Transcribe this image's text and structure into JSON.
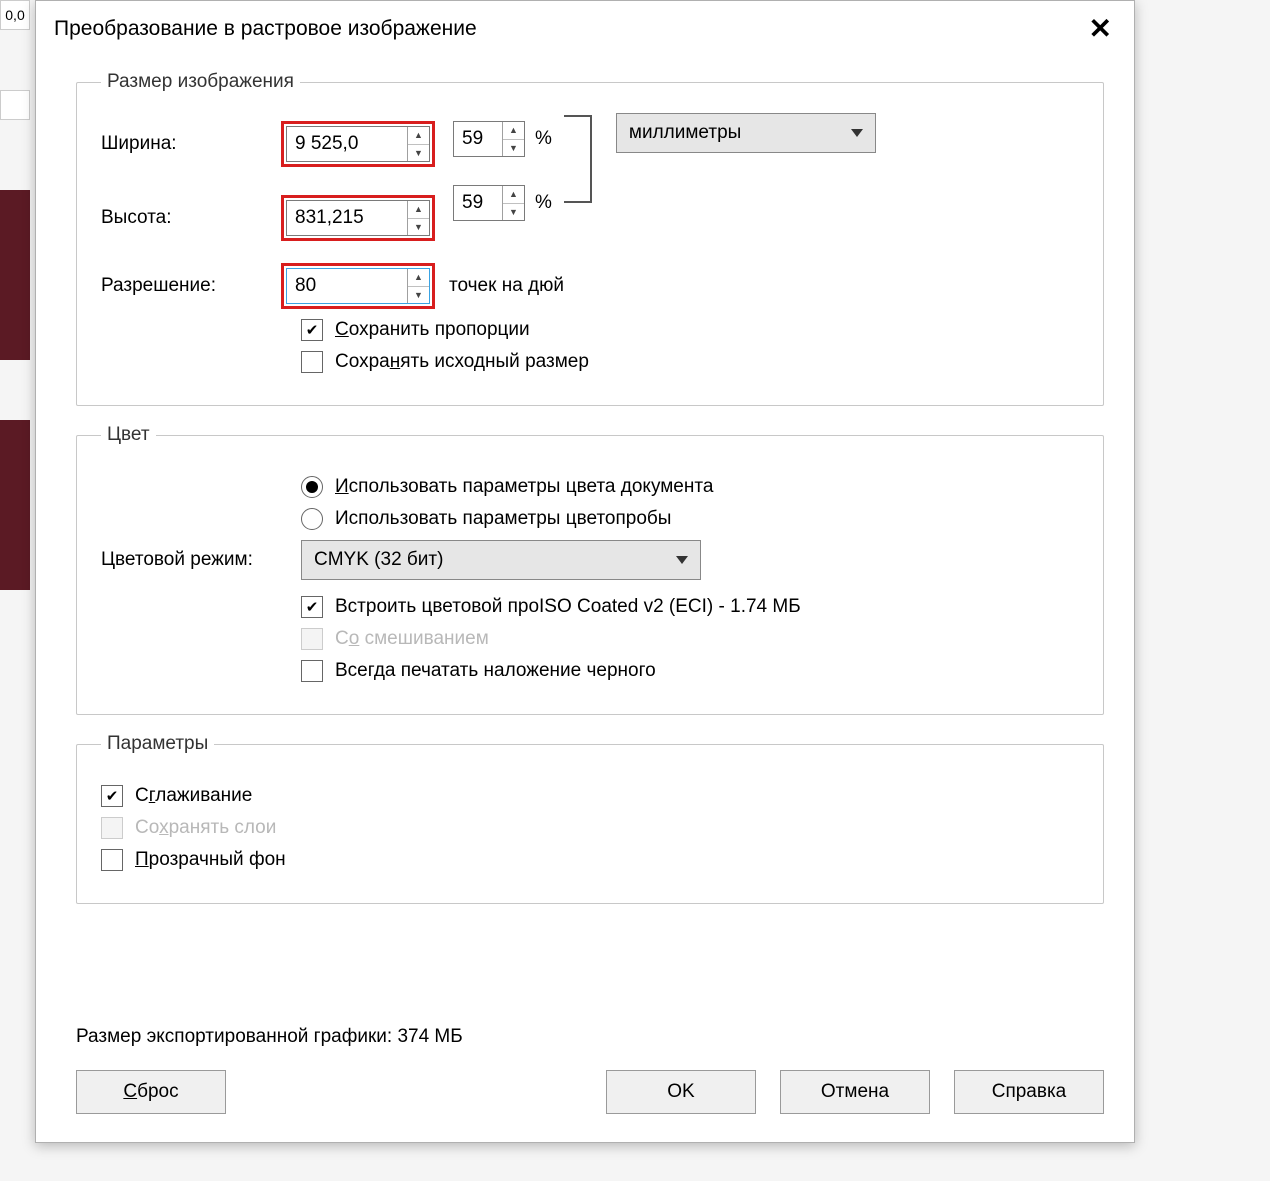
{
  "bg": {
    "ruler_value": "0,0"
  },
  "dialog": {
    "title": "Преобразование в растровое изображение",
    "close": "✕"
  },
  "image_size": {
    "legend": "Размер изображения",
    "width_label": "Ширина:",
    "height_label": "Высота:",
    "resolution_label": "Разрешение:",
    "width_value": "9 525,0",
    "height_value": "831,215",
    "width_percent": "59",
    "height_percent": "59",
    "percent_symbol": "%",
    "resolution_value": "80",
    "resolution_unit": "точек на дюй",
    "units_dropdown": "миллиметры",
    "keep_ratio": "Сохранить пропорции",
    "keep_original_size": "Сохранять исходный размер"
  },
  "color": {
    "legend": "Цвет",
    "use_doc_colors": "Использовать параметры цвета документа",
    "use_proof_colors": "Использовать параметры цветопробы",
    "mode_label": "Цветовой режим:",
    "mode_value": "CMYK (32 бит)",
    "embed_profile": "Встроить цветовой про",
    "profile_info": "ISO Coated v2 (ECI) - 1.74 МБ",
    "dither": "Со смешиванием",
    "always_overprint": "Всегда печатать наложение черного"
  },
  "options": {
    "legend": "Параметры",
    "antialias": "Сглаживание",
    "keep_layers": "Сохранять слои",
    "transparent_bg": "Прозрачный фон"
  },
  "footer": {
    "export_size": "Размер экспортированной графики: 374 МБ",
    "reset": "Сброс",
    "ok": "OK",
    "cancel": "Отмена",
    "help": "Справка"
  }
}
